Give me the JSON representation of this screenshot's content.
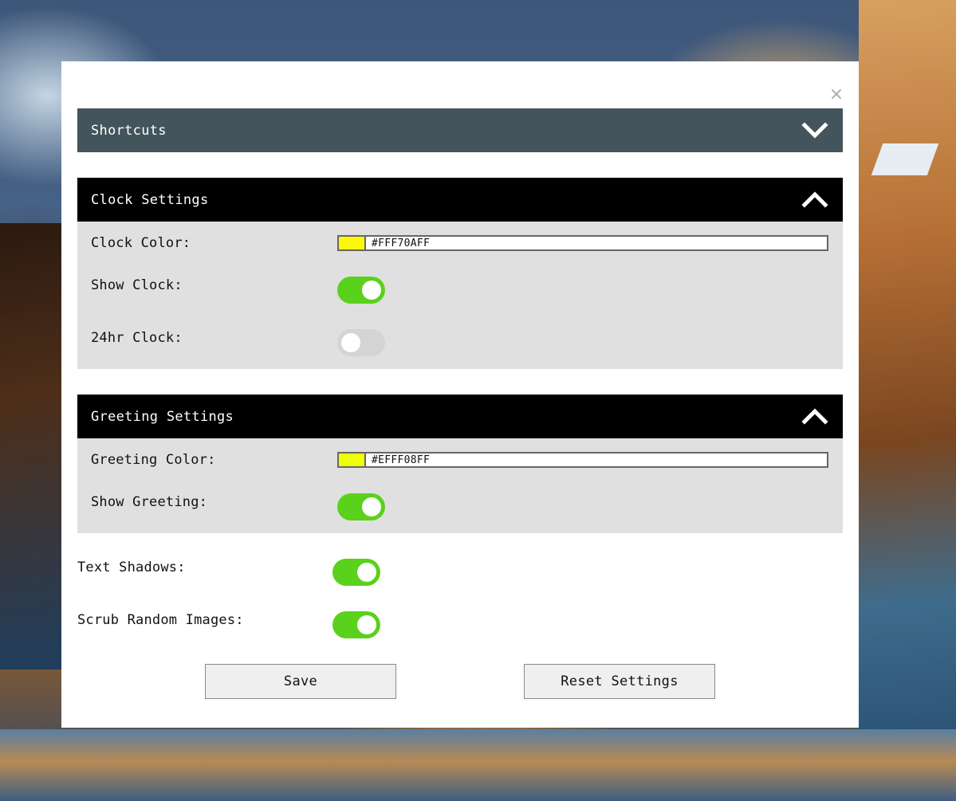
{
  "modal": {
    "close_glyph": "×"
  },
  "shortcuts": {
    "title": "Shortcuts"
  },
  "clock": {
    "title": "Clock Settings",
    "color_label": "Clock Color:",
    "color_value": "#FFF70AFF",
    "color_swatch": "#FFF70A",
    "show_label": "Show Clock:",
    "show_on": true,
    "hr24_label": "24hr Clock:",
    "hr24_on": false
  },
  "greeting": {
    "title": "Greeting Settings",
    "color_label": "Greeting Color:",
    "color_value": "#EFFF08FF",
    "color_swatch": "#EFFF08",
    "show_label": "Show Greeting:",
    "show_on": true
  },
  "general": {
    "shadows_label": "Text Shadows:",
    "shadows_on": true,
    "scrub_label": "Scrub Random Images:",
    "scrub_on": true
  },
  "buttons": {
    "save": "Save",
    "reset": "Reset Settings"
  },
  "colors": {
    "toggle_on": "#5AD11A",
    "toggle_off": "#D4D4D4",
    "header_collapsed": "#43545C",
    "header_expanded": "#000000"
  },
  "icons": {
    "close": "close-icon",
    "collapsed_chevron": "chevron-down-icon",
    "expanded_chevron": "chevron-up-icon"
  }
}
